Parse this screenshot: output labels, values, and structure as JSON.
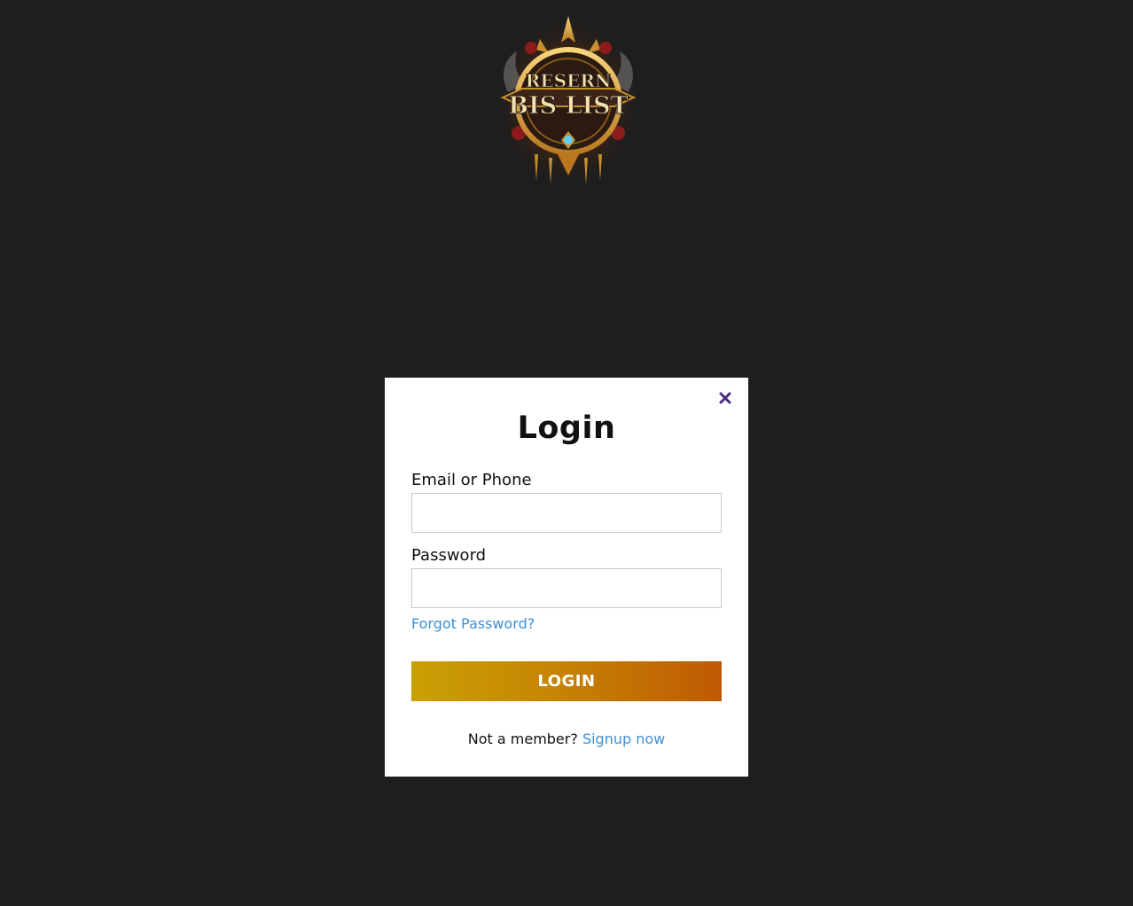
{
  "logo": {
    "line1": "RESERN",
    "line2": "BIS LIST",
    "colors": {
      "gold": "#e8b54a",
      "dark": "#2a1a12",
      "gem": "#5fd0f2",
      "red": "#8c1c1c"
    }
  },
  "modal": {
    "title": "Login",
    "close_icon": "close-icon",
    "email_label": "Email or Phone",
    "email_value": "",
    "password_label": "Password",
    "password_value": "",
    "forgot_link": "Forgot Password?",
    "login_button": "LOGIN",
    "footer_text": "Not a member?",
    "signup_link": "Signup now"
  },
  "colors": {
    "background": "#1e1e1e",
    "link": "#3d8fd6",
    "close": "#4a2a7a",
    "button_gradient_start": "#c9a004",
    "button_gradient_end": "#bf5a03"
  }
}
